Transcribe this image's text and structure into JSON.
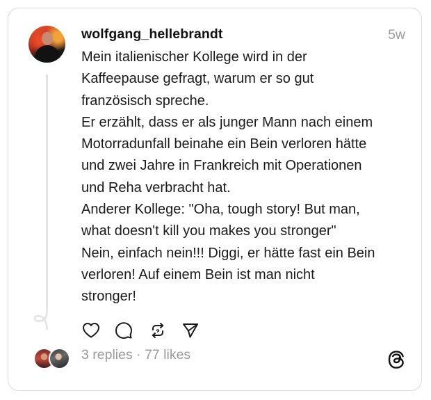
{
  "post": {
    "username": "wolfgang_hellebrandt",
    "timestamp": "5w",
    "text_lines": [
      "Mein italienischer Kollege wird in der",
      "Kaffeepause gefragt, warum er so gut",
      "französisch spreche.",
      "Er erzählt, dass er als junger Mann nach einem",
      "Motorradunfall beinahe ein Bein verloren hätte",
      "und zwei Jahre in Frankreich mit Operationen",
      "und Reha verbracht hat.",
      "Anderer Kollege: \"Oha, tough story! But man,",
      "what doesn't kill you makes you stronger\"",
      "Nein, einfach nein!!! Diggi, er hätte fast ein Bein",
      "verloren! Auf einem Bein ist man nicht",
      "stronger!"
    ]
  },
  "actions": {
    "like_icon": "heart-icon",
    "reply_icon": "comment-icon",
    "repost_icon": "repost-icon",
    "share_icon": "send-icon"
  },
  "stats": {
    "replies": "3 replies",
    "separator": " · ",
    "likes": "77 likes"
  },
  "brand": {
    "logo_icon": "threads-logo-icon"
  },
  "colors": {
    "text": "#1a1a1a",
    "muted": "#9a9a9a",
    "border": "#d9d9d9"
  }
}
